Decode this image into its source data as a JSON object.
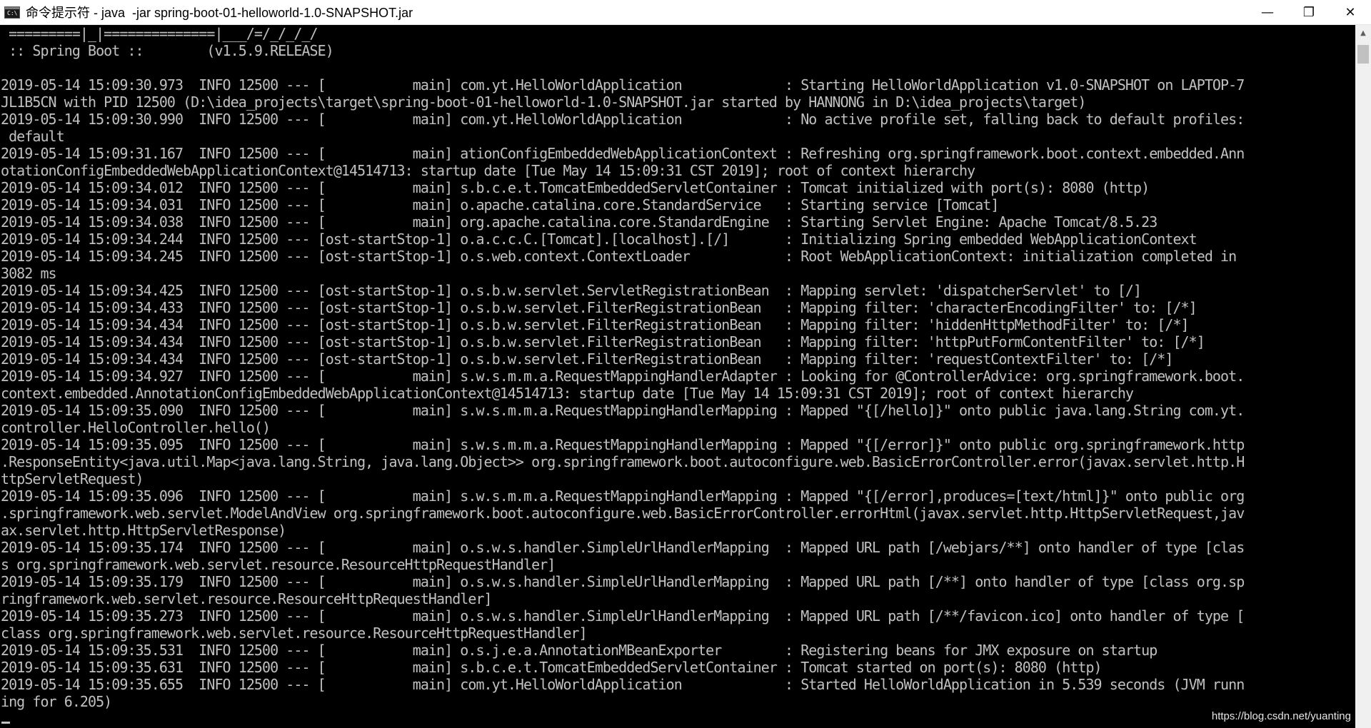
{
  "window": {
    "title": "命令提示符 - java  -jar spring-boot-01-helloworld-1.0-SNAPSHOT.jar",
    "icon_text": "C:\\",
    "minimize_icon": "—",
    "restore_icon": "❐",
    "close_icon": "✕"
  },
  "console": {
    "lines": [
      " =========|_|==============|___/=/_/_/_/",
      " :: Spring Boot ::        (v1.5.9.RELEASE)",
      "",
      "2019-05-14 15:09:30.973  INFO 12500 --- [           main] com.yt.HelloWorldApplication             : Starting HelloWorldApplication v1.0-SNAPSHOT on LAPTOP-7",
      "JL1B5CN with PID 12500 (D:\\idea_projects\\target\\spring-boot-01-helloworld-1.0-SNAPSHOT.jar started by HANNONG in D:\\idea_projects\\target)",
      "2019-05-14 15:09:30.990  INFO 12500 --- [           main] com.yt.HelloWorldApplication             : No active profile set, falling back to default profiles:",
      " default",
      "2019-05-14 15:09:31.167  INFO 12500 --- [           main] ationConfigEmbeddedWebApplicationContext : Refreshing org.springframework.boot.context.embedded.Ann",
      "otationConfigEmbeddedWebApplicationContext@14514713: startup date [Tue May 14 15:09:31 CST 2019]; root of context hierarchy",
      "2019-05-14 15:09:34.012  INFO 12500 --- [           main] s.b.c.e.t.TomcatEmbeddedServletContainer : Tomcat initialized with port(s): 8080 (http)",
      "2019-05-14 15:09:34.031  INFO 12500 --- [           main] o.apache.catalina.core.StandardService   : Starting service [Tomcat]",
      "2019-05-14 15:09:34.038  INFO 12500 --- [           main] org.apache.catalina.core.StandardEngine  : Starting Servlet Engine: Apache Tomcat/8.5.23",
      "2019-05-14 15:09:34.244  INFO 12500 --- [ost-startStop-1] o.a.c.c.C.[Tomcat].[localhost].[/]       : Initializing Spring embedded WebApplicationContext",
      "2019-05-14 15:09:34.245  INFO 12500 --- [ost-startStop-1] o.s.web.context.ContextLoader            : Root WebApplicationContext: initialization completed in",
      "3082 ms",
      "2019-05-14 15:09:34.425  INFO 12500 --- [ost-startStop-1] o.s.b.w.servlet.ServletRegistrationBean  : Mapping servlet: 'dispatcherServlet' to [/]",
      "2019-05-14 15:09:34.433  INFO 12500 --- [ost-startStop-1] o.s.b.w.servlet.FilterRegistrationBean   : Mapping filter: 'characterEncodingFilter' to: [/*]",
      "2019-05-14 15:09:34.434  INFO 12500 --- [ost-startStop-1] o.s.b.w.servlet.FilterRegistrationBean   : Mapping filter: 'hiddenHttpMethodFilter' to: [/*]",
      "2019-05-14 15:09:34.434  INFO 12500 --- [ost-startStop-1] o.s.b.w.servlet.FilterRegistrationBean   : Mapping filter: 'httpPutFormContentFilter' to: [/*]",
      "2019-05-14 15:09:34.434  INFO 12500 --- [ost-startStop-1] o.s.b.w.servlet.FilterRegistrationBean   : Mapping filter: 'requestContextFilter' to: [/*]",
      "2019-05-14 15:09:34.927  INFO 12500 --- [           main] s.w.s.m.m.a.RequestMappingHandlerAdapter : Looking for @ControllerAdvice: org.springframework.boot.",
      "context.embedded.AnnotationConfigEmbeddedWebApplicationContext@14514713: startup date [Tue May 14 15:09:31 CST 2019]; root of context hierarchy",
      "2019-05-14 15:09:35.090  INFO 12500 --- [           main] s.w.s.m.m.a.RequestMappingHandlerMapping : Mapped \"{[/hello]}\" onto public java.lang.String com.yt.",
      "controller.HelloController.hello()",
      "2019-05-14 15:09:35.095  INFO 12500 --- [           main] s.w.s.m.m.a.RequestMappingHandlerMapping : Mapped \"{[/error]}\" onto public org.springframework.http",
      ".ResponseEntity<java.util.Map<java.lang.String, java.lang.Object>> org.springframework.boot.autoconfigure.web.BasicErrorController.error(javax.servlet.http.H",
      "ttpServletRequest)",
      "2019-05-14 15:09:35.096  INFO 12500 --- [           main] s.w.s.m.m.a.RequestMappingHandlerMapping : Mapped \"{[/error],produces=[text/html]}\" onto public org",
      ".springframework.web.servlet.ModelAndView org.springframework.boot.autoconfigure.web.BasicErrorController.errorHtml(javax.servlet.http.HttpServletRequest,jav",
      "ax.servlet.http.HttpServletResponse)",
      "2019-05-14 15:09:35.174  INFO 12500 --- [           main] o.s.w.s.handler.SimpleUrlHandlerMapping  : Mapped URL path [/webjars/**] onto handler of type [clas",
      "s org.springframework.web.servlet.resource.ResourceHttpRequestHandler]",
      "2019-05-14 15:09:35.179  INFO 12500 --- [           main] o.s.w.s.handler.SimpleUrlHandlerMapping  : Mapped URL path [/**] onto handler of type [class org.sp",
      "ringframework.web.servlet.resource.ResourceHttpRequestHandler]",
      "2019-05-14 15:09:35.273  INFO 12500 --- [           main] o.s.w.s.handler.SimpleUrlHandlerMapping  : Mapped URL path [/**/favicon.ico] onto handler of type [",
      "class org.springframework.web.servlet.resource.ResourceHttpRequestHandler]",
      "2019-05-14 15:09:35.531  INFO 12500 --- [           main] o.s.j.e.a.AnnotationMBeanExporter        : Registering beans for JMX exposure on startup",
      "2019-05-14 15:09:35.631  INFO 12500 --- [           main] s.b.c.e.t.TomcatEmbeddedServletContainer : Tomcat started on port(s): 8080 (http)",
      "2019-05-14 15:09:35.655  INFO 12500 --- [           main] com.yt.HelloWorldApplication             : Started HelloWorldApplication in 5.539 seconds (JVM runn",
      "ing for 6.205)"
    ]
  },
  "scrollbar": {
    "up_icon": "▲",
    "down_icon": "▼"
  },
  "watermark": "https://blog.csdn.net/yuanting",
  "colors": {
    "console_bg": "#000000",
    "console_fg": "#c0c0c0",
    "titlebar_bg": "#ffffff"
  }
}
